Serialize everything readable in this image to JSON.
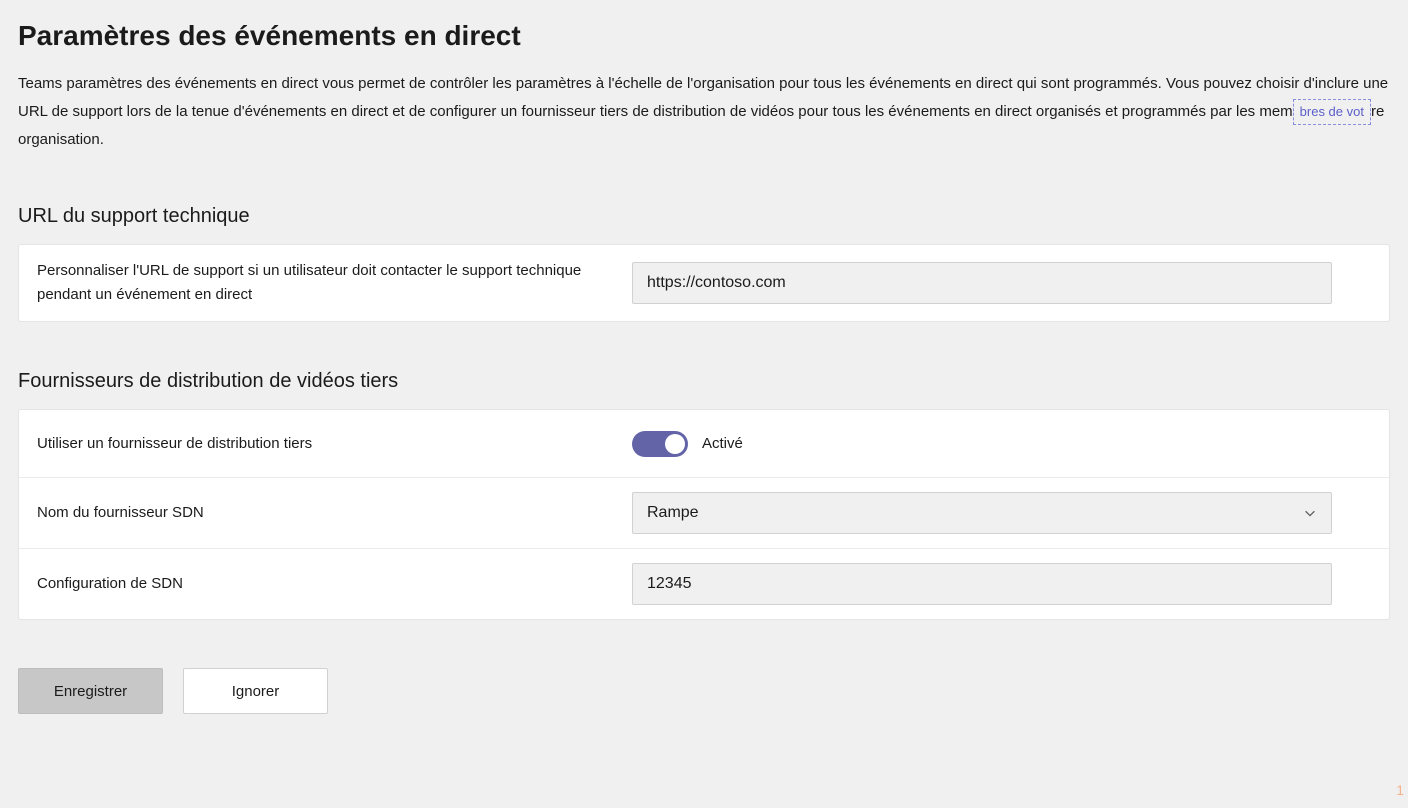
{
  "header": {
    "title": "Paramètres des événements en direct",
    "description_part1": "Teams paramètres des événements en direct vous permet de contrôler les paramètres à l'échelle de l'organisation pour tous les événements en direct qui sont programmés. Vous pouvez choisir d'inclure une URL de support lors de la tenue d'événements en direct et de configurer un fournisseur tiers de distribution de vidéos pour tous les événements en direct organisés et programmés par les mem",
    "link_text": "bres de vot",
    "description_part2": "re organisation."
  },
  "section_support": {
    "heading": "URL du support technique",
    "label": "Personnaliser l'URL de support si un utilisateur doit contacter le support technique pendant un événement en direct",
    "value": "https://contoso.com"
  },
  "section_providers": {
    "heading": "Fournisseurs de distribution de vidéos tiers",
    "toggle_label": "Utiliser un fournisseur de distribution tiers",
    "toggle_state_label": "Activé",
    "toggle_on": true,
    "sdn_name_label": "Nom du fournisseur SDN",
    "sdn_name_value": "Rampe",
    "sdn_config_label": "Configuration de SDN",
    "sdn_config_value": "12345"
  },
  "buttons": {
    "save": "Enregistrer",
    "discard": "Ignorer"
  },
  "page_marker": "1"
}
